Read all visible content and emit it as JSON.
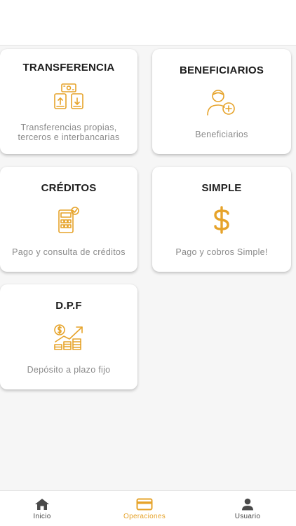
{
  "colors": {
    "accent": "#e6a32a",
    "card_bg": "#ffffff",
    "page_bg": "#f6f6f6",
    "title_text": "#1d1d1d",
    "desc_text": "#8a8a8a",
    "nav_inactive": "#4a4a4a"
  },
  "cards": [
    {
      "title": "TRANSFERENCIA",
      "icon": "money-transfer-icon",
      "description_line1": "Transferencias propias,",
      "description_line2": "terceros e interbancarias"
    },
    {
      "title": "BENEFICIARIOS",
      "icon": "user-add-icon",
      "description_line1": "Beneficiarios"
    },
    {
      "title": "CRÉDITOS",
      "icon": "calculator-icon",
      "description_line1": "Pago y consulta de créditos"
    },
    {
      "title": "SIMPLE",
      "icon": "dollar-icon",
      "description_line1": "Pago y cobros Simple!"
    },
    {
      "title": "D.P.F",
      "icon": "growth-coins-icon",
      "description_line1": "Depósito a plazo fijo"
    }
  ],
  "nav": {
    "items": [
      {
        "label": "Inicio",
        "icon": "home-icon",
        "active": false
      },
      {
        "label": "Operaciones",
        "icon": "card-icon",
        "active": true
      },
      {
        "label": "Usuario",
        "icon": "user-icon",
        "active": false
      }
    ]
  }
}
